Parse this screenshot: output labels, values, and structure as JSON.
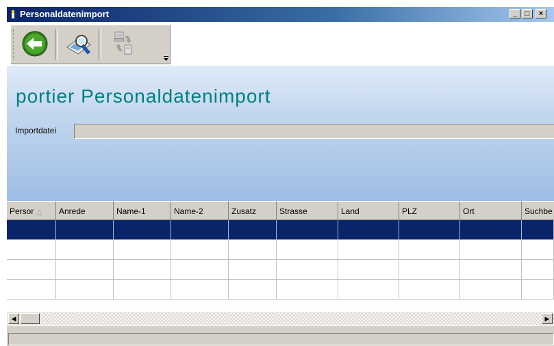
{
  "window": {
    "title": "Personaldatenimport",
    "controls": {
      "minimize": "_",
      "maximize": "□",
      "close": "×"
    }
  },
  "toolbar": {
    "buttons": [
      {
        "name": "back",
        "icon": "back-arrow-icon"
      },
      {
        "name": "preview",
        "icon": "magnifier-document-icon"
      },
      {
        "name": "transfer",
        "icon": "computer-transfer-icon"
      }
    ]
  },
  "header": {
    "app_title": "portier Personaldatenimport",
    "import_label": "Importdatei",
    "import_value": ""
  },
  "grid": {
    "columns": [
      "Persor",
      "Anrede",
      "Name-1",
      "Name-2",
      "Zusatz",
      "Strasse",
      "Land",
      "PLZ",
      "Ort",
      "Suchbe"
    ],
    "sort_indicator": "△",
    "rows": [
      [
        "",
        "",
        "",
        "",
        "",
        "",
        "",
        "",
        "",
        ""
      ],
      [
        "",
        "",
        "",
        "",
        "",
        "",
        "",
        "",
        "",
        ""
      ],
      [
        "",
        "",
        "",
        "",
        "",
        "",
        "",
        "",
        "",
        ""
      ],
      [
        "",
        "",
        "",
        "",
        "",
        "",
        "",
        "",
        "",
        ""
      ]
    ],
    "selected_row_index": 0
  },
  "scrollbar": {
    "left": "◀",
    "right": "▶"
  },
  "colors": {
    "title_bar": "#0a246a",
    "accent_title": "#008080",
    "selection": "#0a246a",
    "header_gradient_bottom": "#9ebde5"
  }
}
